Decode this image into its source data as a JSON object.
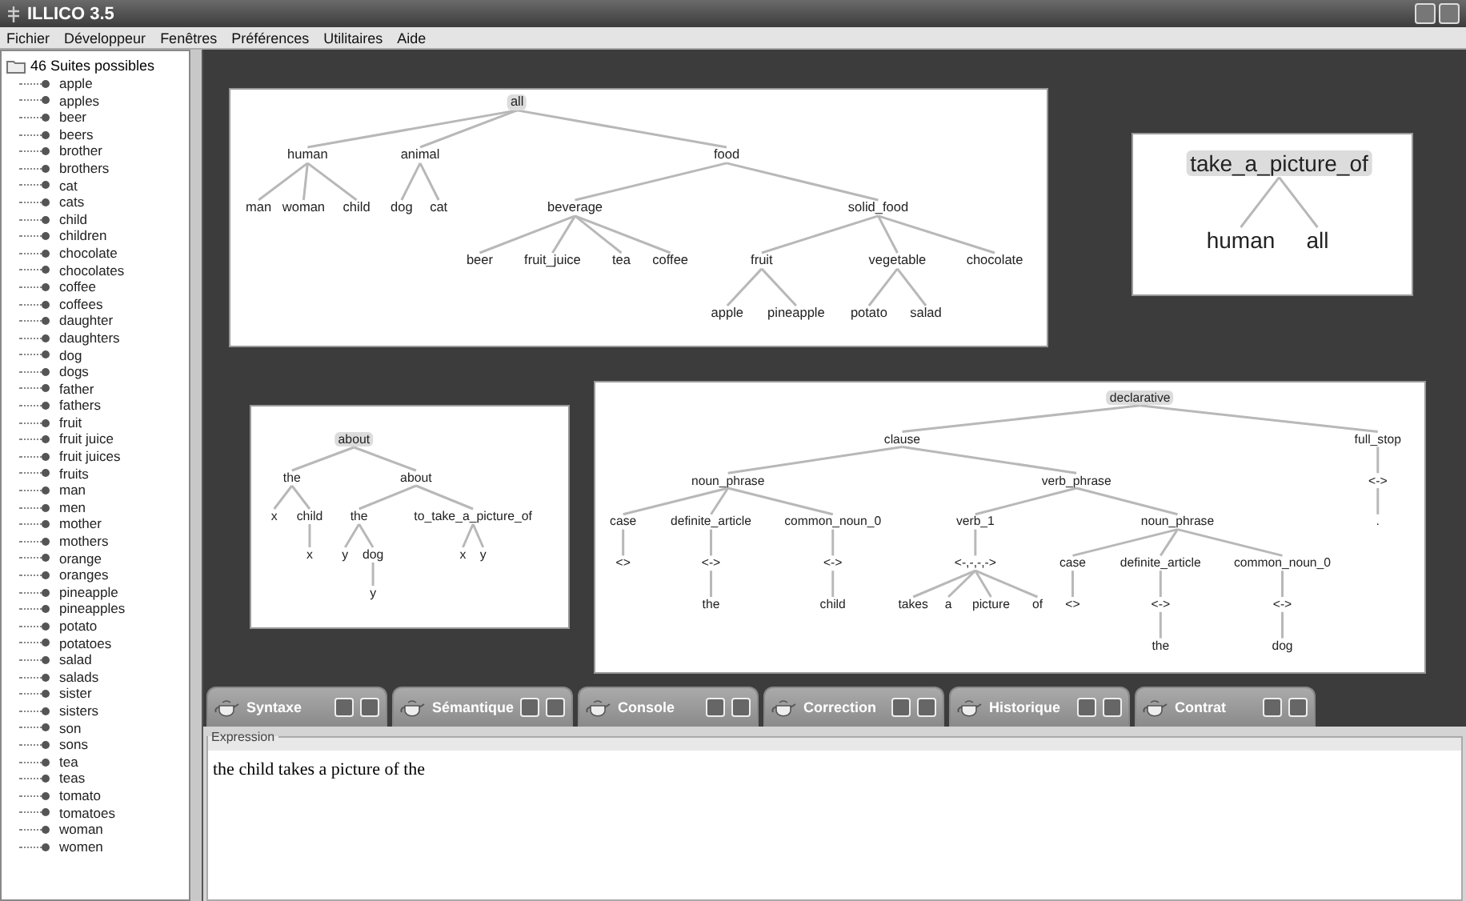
{
  "window": {
    "title": "ILLICO 3.5"
  },
  "menu": [
    "Fichier",
    "Développeur",
    "Fenêtres",
    "Préférences",
    "Utilitaires",
    "Aide"
  ],
  "sidebar": {
    "root": "46 Suites possibles",
    "items": [
      "apple",
      "apples",
      "beer",
      "beers",
      "brother",
      "brothers",
      "cat",
      "cats",
      "child",
      "children",
      "chocolate",
      "chocolates",
      "coffee",
      "coffees",
      "daughter",
      "daughters",
      "dog",
      "dogs",
      "father",
      "fathers",
      "fruit",
      "fruit juice",
      "fruit juices",
      "fruits",
      "man",
      "men",
      "mother",
      "mothers",
      "orange",
      "oranges",
      "pineapple",
      "pineapples",
      "potato",
      "potatoes",
      "salad",
      "salads",
      "sister",
      "sisters",
      "son",
      "sons",
      "tea",
      "teas",
      "tomato",
      "tomatoes",
      "woman",
      "women"
    ]
  },
  "tree_panels": [
    {
      "tree": {
        "label": "all",
        "children": [
          {
            "label": "human",
            "children": [
              {
                "label": "man"
              },
              {
                "label": "woman"
              },
              {
                "label": "child"
              }
            ]
          },
          {
            "label": "animal",
            "children": [
              {
                "label": "dog"
              },
              {
                "label": "cat"
              }
            ]
          },
          {
            "label": "food",
            "children": [
              {
                "label": "beverage",
                "children": [
                  {
                    "label": "beer"
                  },
                  {
                    "label": "fruit_juice"
                  },
                  {
                    "label": "tea"
                  },
                  {
                    "label": "coffee"
                  }
                ]
              },
              {
                "label": "solid_food",
                "children": [
                  {
                    "label": "fruit",
                    "children": [
                      {
                        "label": "apple"
                      },
                      {
                        "label": "pineapple"
                      }
                    ]
                  },
                  {
                    "label": "vegetable",
                    "children": [
                      {
                        "label": "potato"
                      },
                      {
                        "label": "salad"
                      }
                    ]
                  },
                  {
                    "label": "chocolate"
                  }
                ]
              }
            ]
          }
        ]
      }
    },
    {
      "tree": {
        "label": "take_a_picture_of",
        "children": [
          {
            "label": "human"
          },
          {
            "label": "all"
          }
        ]
      }
    },
    {
      "tree": {
        "label": "about",
        "children": [
          {
            "label": "the",
            "children": [
              {
                "label": "x"
              },
              {
                "label": "child",
                "children": [
                  {
                    "label": "x"
                  }
                ]
              }
            ]
          },
          {
            "label": "about",
            "children": [
              {
                "label": "the",
                "children": [
                  {
                    "label": "y"
                  },
                  {
                    "label": "dog",
                    "children": [
                      {
                        "label": "y"
                      }
                    ]
                  }
                ]
              },
              {
                "label": "to_take_a_picture_of",
                "children": [
                  {
                    "label": "x"
                  },
                  {
                    "label": "y"
                  }
                ]
              }
            ]
          }
        ]
      }
    },
    {
      "tree": {
        "label": "declarative",
        "children": [
          {
            "label": "clause",
            "children": [
              {
                "label": "noun_phrase",
                "children": [
                  {
                    "label": "case",
                    "children": [
                      {
                        "label": "<>"
                      }
                    ]
                  },
                  {
                    "label": "definite_article",
                    "children": [
                      {
                        "label": "<->",
                        "children": [
                          {
                            "label": "the"
                          }
                        ]
                      }
                    ]
                  },
                  {
                    "label": "common_noun_0",
                    "children": [
                      {
                        "label": "<->",
                        "children": [
                          {
                            "label": "child"
                          }
                        ]
                      }
                    ]
                  }
                ]
              },
              {
                "label": "verb_phrase",
                "children": [
                  {
                    "label": "verb_1",
                    "children": [
                      {
                        "label": "<-,-,-,->",
                        "children": [
                          {
                            "label": "takes"
                          },
                          {
                            "label": "a"
                          },
                          {
                            "label": "picture"
                          },
                          {
                            "label": "of"
                          }
                        ]
                      }
                    ]
                  },
                  {
                    "label": "noun_phrase",
                    "children": [
                      {
                        "label": "case",
                        "children": [
                          {
                            "label": "<>"
                          }
                        ]
                      },
                      {
                        "label": "definite_article",
                        "children": [
                          {
                            "label": "<->",
                            "children": [
                              {
                                "label": "the"
                              }
                            ]
                          }
                        ]
                      },
                      {
                        "label": "common_noun_0",
                        "children": [
                          {
                            "label": "<->",
                            "children": [
                              {
                                "label": "dog"
                              }
                            ]
                          }
                        ]
                      }
                    ]
                  }
                ]
              }
            ]
          },
          {
            "label": "full_stop",
            "children": [
              {
                "label": "<->",
                "children": [
                  {
                    "label": "."
                  }
                ]
              }
            ]
          }
        ]
      }
    }
  ],
  "tabs": [
    {
      "label": "Syntaxe"
    },
    {
      "label": "Sémantique"
    },
    {
      "label": "Console"
    },
    {
      "label": "Correction"
    },
    {
      "label": "Historique"
    },
    {
      "label": "Contrat"
    }
  ],
  "expression": {
    "title": "Expression",
    "value": "the child takes a picture of the"
  }
}
